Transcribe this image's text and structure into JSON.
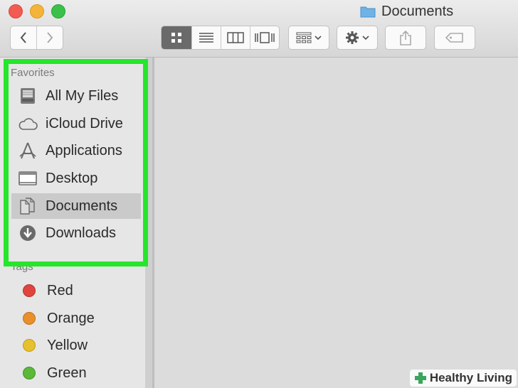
{
  "window": {
    "title": "Documents"
  },
  "toolbar": {
    "back": "back",
    "forward": "forward",
    "views": [
      "icon-view",
      "list-view",
      "column-view",
      "cover-flow-view"
    ],
    "arrange": "arrange",
    "action": "action",
    "share": "share",
    "tags": "edit-tags"
  },
  "sidebar": {
    "favorites_header": "Favorites",
    "favorites": [
      {
        "label": "All My Files",
        "icon": "all-files-icon"
      },
      {
        "label": "iCloud Drive",
        "icon": "cloud-icon"
      },
      {
        "label": "Applications",
        "icon": "applications-icon"
      },
      {
        "label": "Desktop",
        "icon": "desktop-icon"
      },
      {
        "label": "Documents",
        "icon": "documents-icon",
        "selected": true
      },
      {
        "label": "Downloads",
        "icon": "downloads-icon"
      }
    ],
    "tags_header": "Tags",
    "tags": [
      {
        "label": "Red",
        "color": "#e0443e"
      },
      {
        "label": "Orange",
        "color": "#e9902b"
      },
      {
        "label": "Yellow",
        "color": "#e7c02f"
      },
      {
        "label": "Green",
        "color": "#5cb838"
      }
    ]
  },
  "colors": {
    "highlight": "#25e62b",
    "selection": "#cacaca"
  },
  "watermark": {
    "text": "Healthy Living"
  }
}
